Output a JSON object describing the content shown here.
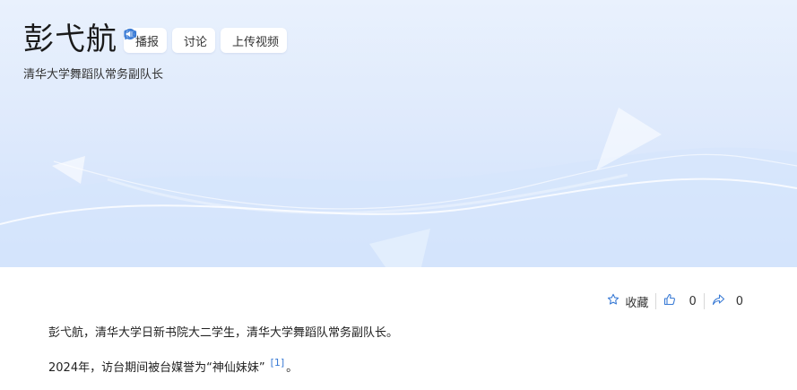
{
  "header": {
    "title": "彭弋航",
    "subtitle": "清华大学舞蹈队常务副队长",
    "actions": [
      {
        "label": "播报",
        "icon": "speaker-icon"
      },
      {
        "label": "讨论",
        "icon": "chat-bubble-icon"
      },
      {
        "label": "上传视频",
        "icon": "video-camera-icon"
      }
    ]
  },
  "toolbar": {
    "favorite_label": "收藏",
    "like_count": "0",
    "share_count": "0"
  },
  "content": {
    "paragraph1": "彭弋航，清华大学日新书院大二学生，清华大学舞蹈队常务副队长。",
    "paragraph2_text": "2024年，访台期间被台媒誉为“神仙妹妹”",
    "paragraph2_ref": "[1]",
    "paragraph2_end": "。"
  },
  "colors": {
    "accent": "#3a7bd5",
    "banner_top": "#e9f1fd",
    "banner_bottom": "#cfe1fb"
  }
}
